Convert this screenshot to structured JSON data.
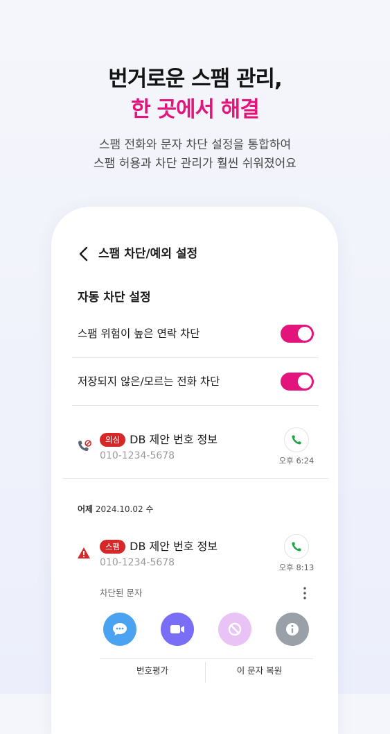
{
  "hero": {
    "title_line1": "번거로운 스팸 관리,",
    "title_line2": "한 곳에서 해결",
    "subtitle_line1": "스팸 전화와 문자 차단 설정을 통합하여",
    "subtitle_line2": "스팸 허용과 차단 관리가 훨씬 쉬워졌어요"
  },
  "screen": {
    "title": "스팸 차단/예외 설정",
    "auto_block": {
      "heading": "자동 차단 설정",
      "settings": [
        {
          "label": "스팸 위험이 높은 연락 차단",
          "enabled": true
        },
        {
          "label": "저장되지 않은/모르는 전화 차단",
          "enabled": true
        }
      ]
    },
    "call_item": {
      "badge": "의심",
      "name": "DB 제안 번호 정보",
      "number": "010-1234-5678",
      "time": "오후 6:24"
    },
    "date_header": {
      "label": "어제",
      "date": "2024.10.02 수"
    },
    "message_item": {
      "badge": "스팸",
      "name": "DB 제안 번호 정보",
      "number": "010-1234-5678",
      "time": "오후 8:13",
      "blocked_label": "차단된 문자"
    },
    "bottom_actions": {
      "rate_label": "번호평가",
      "restore_label": "이 문자 복원"
    }
  },
  "colors": {
    "accent": "#e3157d",
    "badge_red": "#d62828",
    "call_green": "#1fa34a",
    "message_blue": "#4aa3f0",
    "video_purple": "#7b6ef6",
    "block_lilac": "#e9c3f5",
    "info_gray": "#9aa0a8"
  },
  "icons": {
    "back": "chevron-left-icon",
    "call": "phone-icon",
    "blocked_call": "blocked-call-icon",
    "warning": "warning-triangle-icon",
    "more": "more-vertical-icon",
    "message": "chat-bubble-icon",
    "video": "video-camera-icon",
    "block": "block-icon",
    "info": "info-icon"
  }
}
